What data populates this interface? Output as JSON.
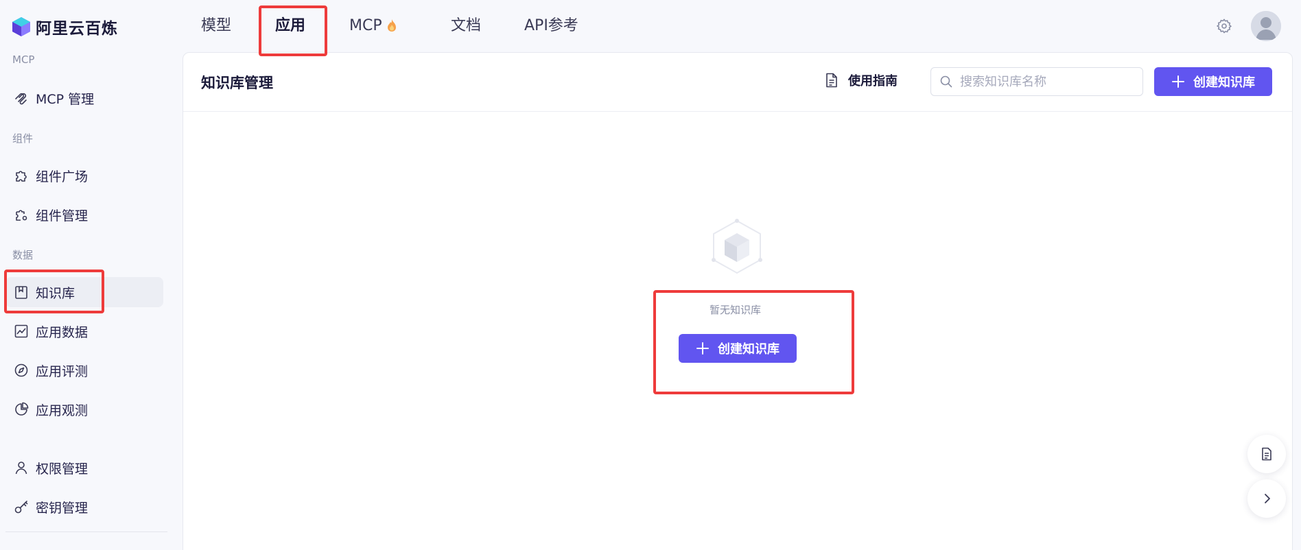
{
  "brand": {
    "name": "阿里云百炼",
    "logo_icon": "bailian-logo-icon"
  },
  "nav": {
    "tabs": [
      {
        "label": "模型"
      },
      {
        "label": "应用",
        "active": true
      },
      {
        "label": "MCP",
        "icon": "fire-icon"
      },
      {
        "label": "文档"
      },
      {
        "label": "API参考"
      }
    ]
  },
  "header_icons": {
    "settings": "gear-icon",
    "avatar": "user-avatar"
  },
  "sidebar": {
    "groups": [
      {
        "title": "MCP",
        "items": [
          {
            "label": "MCP 管理",
            "icon": "mcp-manage-icon"
          }
        ]
      },
      {
        "title": "组件",
        "items": [
          {
            "label": "组件广场",
            "icon": "puzzle-icon"
          },
          {
            "label": "组件管理",
            "icon": "puzzle-gear-icon"
          }
        ]
      },
      {
        "title": "数据",
        "items": [
          {
            "label": "知识库",
            "icon": "book-icon",
            "active": true
          },
          {
            "label": "应用数据",
            "icon": "chart-line-icon"
          },
          {
            "label": "应用评测",
            "icon": "compass-icon"
          },
          {
            "label": "应用观测",
            "icon": "pie-chart-icon"
          }
        ]
      },
      {
        "title": "",
        "items": [
          {
            "label": "权限管理",
            "icon": "user-icon"
          },
          {
            "label": "密钥管理",
            "icon": "key-icon"
          }
        ]
      }
    ]
  },
  "panel": {
    "title": "知识库管理",
    "guide_label": "使用指南",
    "search_placeholder": "搜索知识库名称",
    "create_label": "创建知识库",
    "empty_text": "暂无知识库",
    "empty_create_label": "创建知识库"
  },
  "colors": {
    "accent": "#6155f0",
    "highlight": "#ee3b3b",
    "sidebar_bg": "#f7f8fc"
  }
}
